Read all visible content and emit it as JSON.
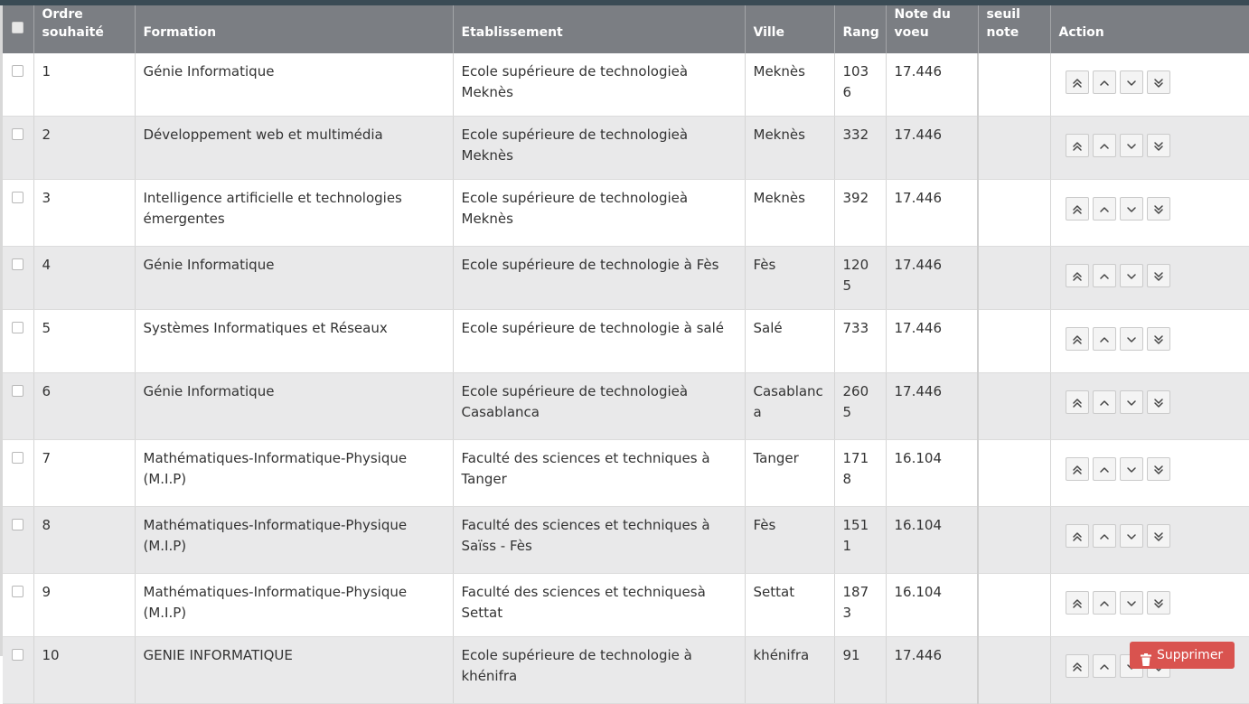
{
  "table": {
    "headers": {
      "order": "Ordre souhaité",
      "formation": "Formation",
      "etablissement": "Etablissement",
      "ville": "Ville",
      "rang": "Rang",
      "note": "Note du voeu",
      "seuil": "seuil note",
      "action": "Action"
    },
    "rows": [
      {
        "order": "1",
        "formation": "Génie Informatique",
        "etablissement": "Ecole supérieure de technologieà Meknès",
        "ville": "Meknès",
        "rang": "1036",
        "note": "17.446",
        "seuil": ""
      },
      {
        "order": "2",
        "formation": "Développement web et multimédia",
        "etablissement": "Ecole supérieure de technologieà Meknès",
        "ville": "Meknès",
        "rang": "332",
        "note": "17.446",
        "seuil": ""
      },
      {
        "order": "3",
        "formation": "Intelligence artificielle et technologies émergentes",
        "etablissement": "Ecole supérieure de technologieà Meknès",
        "ville": "Meknès",
        "rang": "392",
        "note": "17.446",
        "seuil": ""
      },
      {
        "order": "4",
        "formation": "Génie Informatique",
        "etablissement": "Ecole supérieure de technologie à Fès",
        "ville": "Fès",
        "rang": "1205",
        "note": "17.446",
        "seuil": ""
      },
      {
        "order": "5",
        "formation": "Systèmes Informatiques et Réseaux",
        "etablissement": "Ecole supérieure de technologie à salé",
        "ville": "Salé",
        "rang": "733",
        "note": "17.446",
        "seuil": ""
      },
      {
        "order": "6",
        "formation": "Génie Informatique",
        "etablissement": "Ecole supérieure de technologieà Casablanca",
        "ville": "Casablanca",
        "rang": "2605",
        "note": "17.446",
        "seuil": ""
      },
      {
        "order": "7",
        "formation": "Mathématiques-Informatique-Physique (M.I.P)",
        "etablissement": "Faculté des sciences et techniques à Tanger",
        "ville": "Tanger",
        "rang": "1718",
        "note": "16.104",
        "seuil": ""
      },
      {
        "order": "8",
        "formation": "Mathématiques-Informatique-Physique (M.I.P)",
        "etablissement": "Faculté des sciences et techniques à Saïss - Fès",
        "ville": "Fès",
        "rang": "1511",
        "note": "16.104",
        "seuil": ""
      },
      {
        "order": "9",
        "formation": "Mathématiques-Informatique-Physique (M.I.P)",
        "etablissement": "Faculté des sciences et techniquesà Settat",
        "ville": "Settat",
        "rang": "1873",
        "note": "16.104",
        "seuil": ""
      },
      {
        "order": "10",
        "formation": "GENIE INFORMATIQUE",
        "etablissement": "Ecole supérieure de technologie à khénifra",
        "ville": "khénifra",
        "rang": "91",
        "note": "17.446",
        "seuil": ""
      }
    ],
    "action_icons": [
      "chevron-double-up-icon",
      "chevron-up-icon",
      "chevron-down-icon",
      "chevron-double-down-icon"
    ]
  },
  "footer": {
    "delete_label": "Supprimer",
    "delete_icon": "trash-icon"
  },
  "colors": {
    "header_bg": "#7b7e83",
    "row_alt_bg": "#e9e9ea",
    "delete_bg": "#d9534f"
  }
}
